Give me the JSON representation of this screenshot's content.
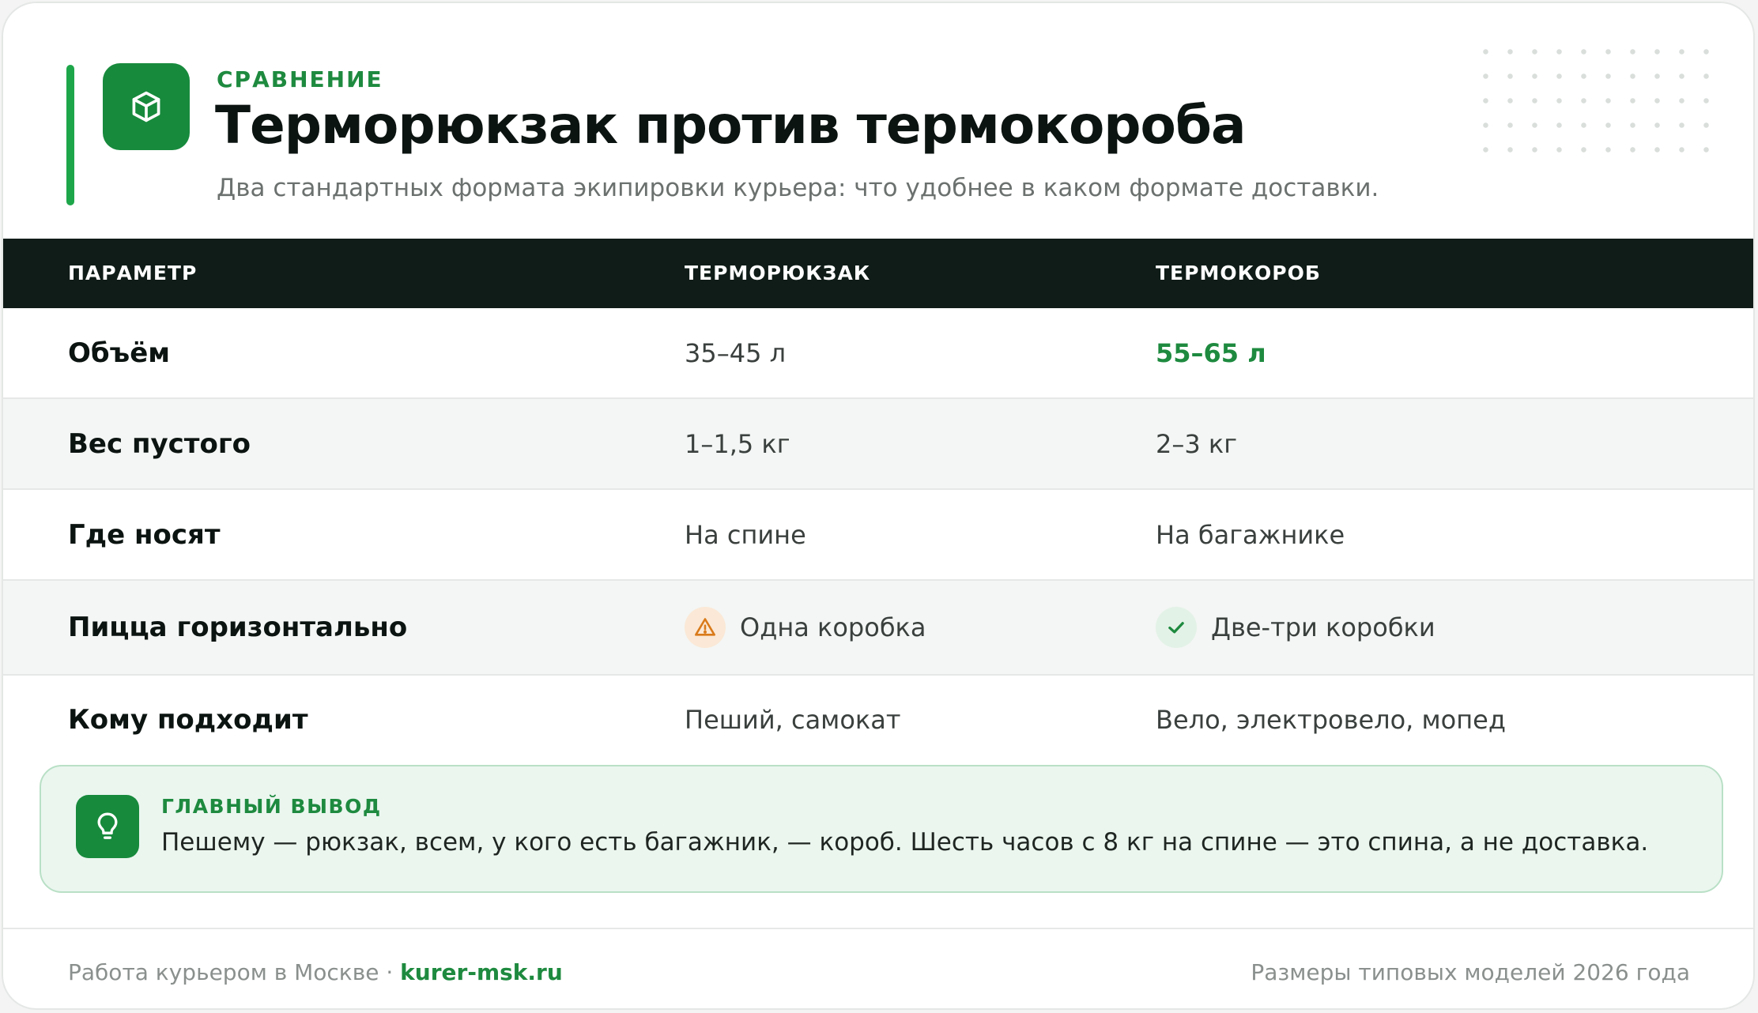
{
  "colors": {
    "accent": "#1e8a3f",
    "accent_bar": "#1ea64a",
    "header_bg": "#0f1c17",
    "warn": "#d97a1a",
    "takeaway_bg": "#ebf6ef"
  },
  "header": {
    "eyebrow": "СРАВНЕНИЕ",
    "title": "Терморюкзак против термокороба",
    "subtitle": "Два стандартных формата экипировки курьера: что удобнее в каком формате доставки.",
    "logo_icon": "box-icon"
  },
  "table": {
    "columns": [
      "ПАРАМЕТР",
      "ТЕРМОРЮКЗАК",
      "ТЕРМОКОРОБ"
    ],
    "rows": [
      {
        "param": "Объём",
        "backpack": "35–45 л",
        "box": "55–65 л"
      },
      {
        "param": "Вес пустого",
        "backpack": "1–1,5 кг",
        "box": "2–3 кг"
      },
      {
        "param": "Где носят",
        "backpack": "На спине",
        "box": "На багажнике"
      },
      {
        "param": "Пицца горизонтально",
        "backpack": "Одна коробка",
        "box": "Две-три коробки",
        "backpack_icon": "warning-icon",
        "box_icon": "check-icon"
      },
      {
        "param": "Кому подходит",
        "backpack": "Пеший, самокат",
        "box": "Вело, электровело, мопед"
      }
    ]
  },
  "takeaway": {
    "label": "ГЛАВНЫЙ ВЫВОД",
    "text": "Пешему — рюкзак, всем, у кого есть багажник, — короб. Шесть часов с 8 кг на спине — это спина, а не доставка.",
    "icon": "lightbulb-icon"
  },
  "footer": {
    "left_text": "Работа курьером в Москве · ",
    "site": "kurer-msk.ru",
    "right_text": "Размеры типовых моделей 2026 года"
  }
}
